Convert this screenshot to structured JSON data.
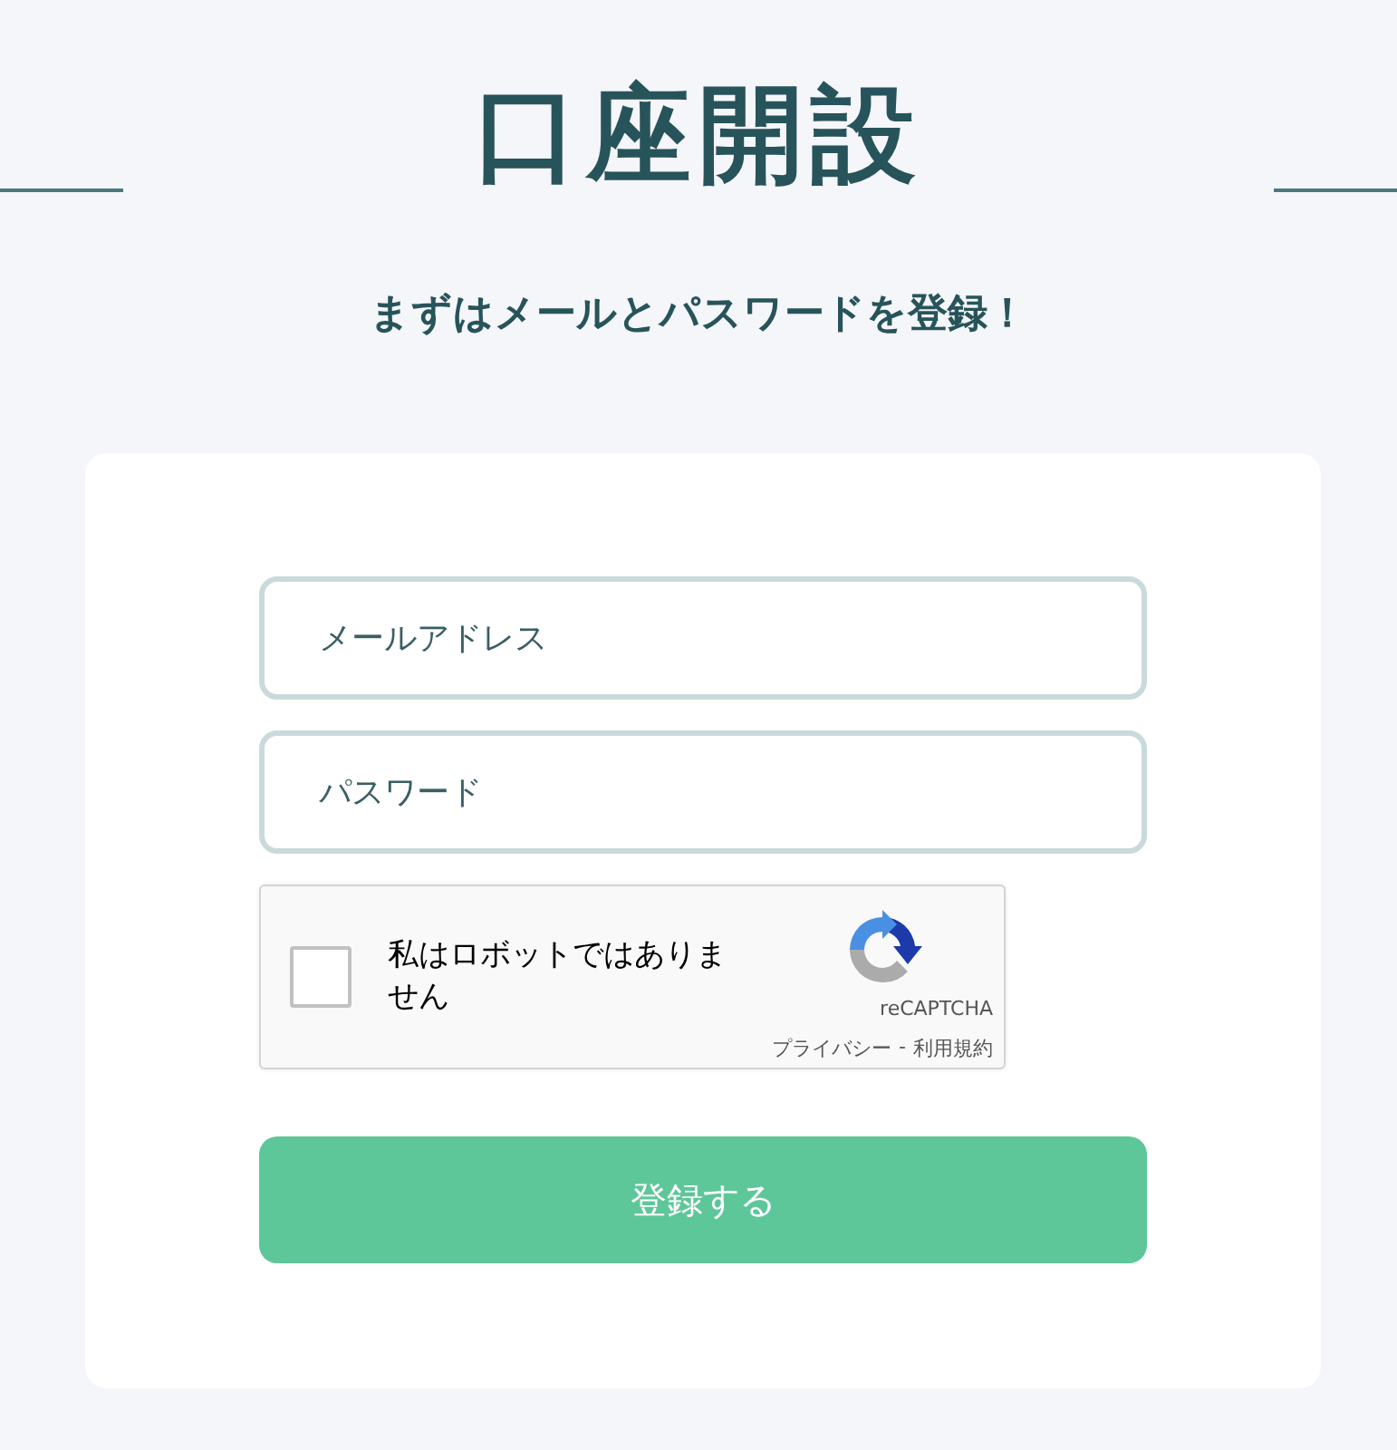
{
  "title": "口座開設",
  "subtitle": "まずはメールとパスワードを登録！",
  "form": {
    "fields": [
      {
        "placeholder": "メールアドレス"
      },
      {
        "placeholder": "パスワード"
      }
    ],
    "captcha": {
      "label": "私はロボットではありません",
      "checked": false,
      "brand": "reCAPTCHA",
      "privacy": "プライバシー",
      "separator": "-",
      "terms": "利用規約"
    },
    "submit": "登録する"
  }
}
